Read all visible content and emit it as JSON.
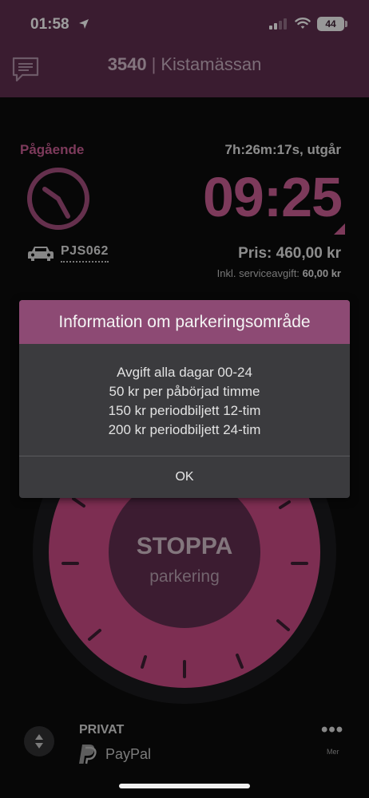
{
  "status_bar": {
    "time": "01:58",
    "battery": "44"
  },
  "nav": {
    "zone_code": "3540",
    "zone_sep": "|",
    "zone_name": "Kistamässan"
  },
  "session": {
    "status": "Pågående",
    "remaining": "7h:26m:17s, utgår",
    "end_time": "09:25",
    "plate": "PJS062",
    "price": "Pris: 460,00 kr",
    "fee_label": "Inkl. serviceavgift:",
    "fee_value": "60,00 kr"
  },
  "dial": {
    "title": "STOPPA",
    "subtitle": "parkering"
  },
  "alert": {
    "title": "Information om parkeringsområde",
    "lines": [
      "Avgift alla dagar 00-24",
      "50 kr per påbörjad timme",
      "150 kr periodbiljett 12-tim",
      "200 kr periodbiljett 24-tim"
    ],
    "ok": "OK"
  },
  "payment": {
    "type": "PRIVAT",
    "method": "PayPal",
    "more_label": "Mer"
  },
  "colors": {
    "brand_purple": "#5a2c4a",
    "accent_pink": "#c05a8c",
    "dialog_header": "#8d4a74"
  },
  "icons": [
    "location-arrow-icon",
    "signal-icon",
    "wifi-icon",
    "message-icon",
    "clock-icon",
    "car-icon",
    "corner-triangle-icon",
    "sort-icon",
    "paypal-icon",
    "more-icon"
  ]
}
